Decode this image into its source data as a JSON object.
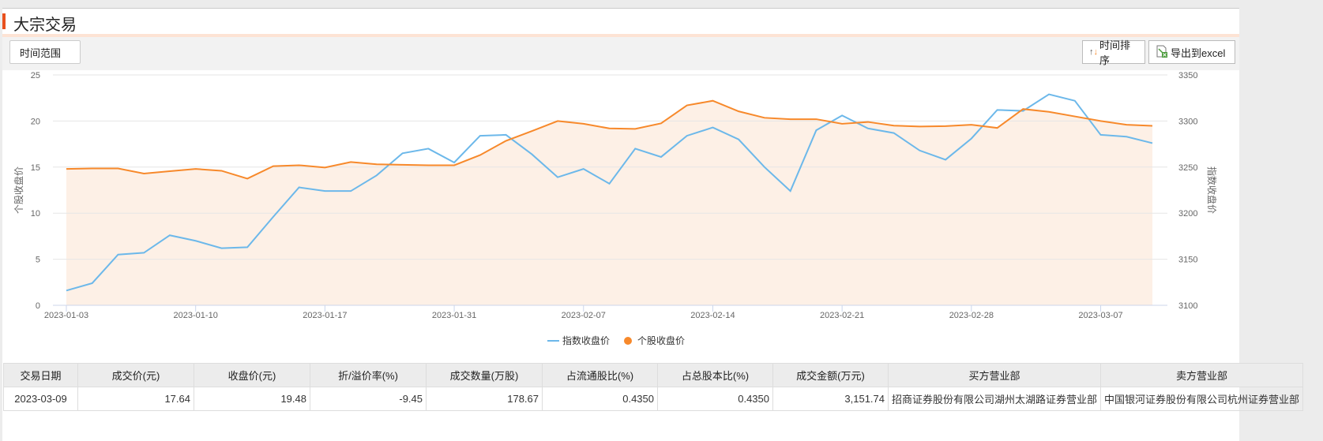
{
  "header": {
    "title": "大宗交易"
  },
  "toolbar": {
    "time_range": "时间范围",
    "sort": "时间排序",
    "export": "导出到excel"
  },
  "colors": {
    "stock": "#f7892b",
    "index": "#6cb8ea",
    "fill": "#fdf0e6",
    "accent": "#e8501e"
  },
  "chart_data": {
    "type": "line",
    "x": [
      "2023-01-03",
      "2023-01-04",
      "2023-01-05",
      "2023-01-06",
      "2023-01-09",
      "2023-01-10",
      "2023-01-11",
      "2023-01-12",
      "2023-01-13",
      "2023-01-16",
      "2023-01-17",
      "2023-01-18",
      "2023-01-19",
      "2023-01-20",
      "2023-01-30",
      "2023-01-31",
      "2023-02-01",
      "2023-02-02",
      "2023-02-03",
      "2023-02-06",
      "2023-02-07",
      "2023-02-08",
      "2023-02-09",
      "2023-02-10",
      "2023-02-13",
      "2023-02-14",
      "2023-02-15",
      "2023-02-16",
      "2023-02-17",
      "2023-02-20",
      "2023-02-21",
      "2023-02-22",
      "2023-02-23",
      "2023-02-24",
      "2023-02-27",
      "2023-02-28",
      "2023-03-01",
      "2023-03-02",
      "2023-03-03",
      "2023-03-06",
      "2023-03-07",
      "2023-03-08",
      "2023-03-09"
    ],
    "x_ticks": [
      "2023-01-03",
      "2023-01-10",
      "2023-01-17",
      "2023-01-31",
      "2023-02-07",
      "2023-02-14",
      "2023-02-21",
      "2023-02-28",
      "2023-03-07"
    ],
    "series": [
      {
        "name": "指数收盘价",
        "axis": "right",
        "values": [
          3116,
          3124,
          3155,
          3157,
          3176,
          3170,
          3162,
          3163,
          3196,
          3228,
          3224,
          3224,
          3241,
          3265,
          3270,
          3255,
          3284,
          3285,
          3264,
          3239,
          3248,
          3232,
          3270,
          3261,
          3284,
          3293,
          3280,
          3250,
          3224,
          3290,
          3306,
          3292,
          3287,
          3268,
          3258,
          3281,
          3312,
          3311,
          3329,
          3322,
          3285,
          3283,
          3276
        ]
      },
      {
        "name": "个股收盘价",
        "axis": "left",
        "area": true,
        "values": [
          14.8,
          14.85,
          14.85,
          14.3,
          14.55,
          14.8,
          14.6,
          13.75,
          15.1,
          15.2,
          14.95,
          15.55,
          15.3,
          15.25,
          15.2,
          15.2,
          16.3,
          17.85,
          18.9,
          20.0,
          19.7,
          19.2,
          19.15,
          19.75,
          21.7,
          22.2,
          21.05,
          20.35,
          20.2,
          20.2,
          19.7,
          19.9,
          19.5,
          19.4,
          19.45,
          19.6,
          19.25,
          21.3,
          21.0,
          20.5,
          20.0,
          19.6,
          19.48
        ]
      }
    ],
    "ylabel": "个股收盘价",
    "y2label": "指数收盘价",
    "ylim": [
      0,
      25
    ],
    "yticks": [
      "0",
      "5",
      "10",
      "15",
      "20",
      "25"
    ],
    "y2lim": [
      3100,
      3350
    ],
    "y2ticks": [
      "3100",
      "3150",
      "3200",
      "3250",
      "3300",
      "3350"
    ],
    "grid": true,
    "legend": "bottom"
  },
  "table": {
    "headers": [
      "交易日期",
      "成交价(元)",
      "收盘价(元)",
      "折/溢价率(%)",
      "成交数量(万股)",
      "占流通股比(%)",
      "占总股本比(%)",
      "成交金额(万元)",
      "买方营业部",
      "卖方营业部"
    ],
    "rows": [
      [
        "2023-03-09",
        "17.64",
        "19.48",
        "-9.45",
        "178.67",
        "0.4350",
        "0.4350",
        "3,151.74",
        "招商证券股份有限公司湖州太湖路证券营业部",
        "中国银河证券股份有限公司杭州证券营业部"
      ]
    ]
  }
}
